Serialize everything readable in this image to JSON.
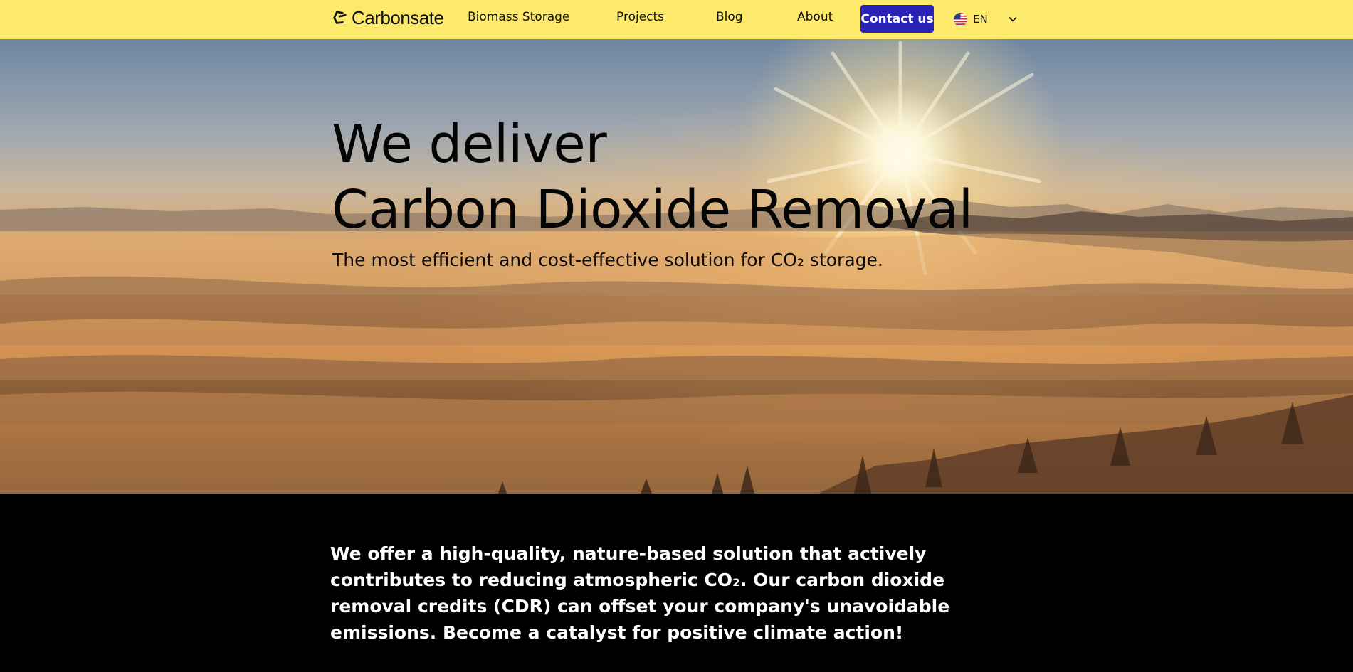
{
  "brand": {
    "name": "Carbonsate"
  },
  "nav": {
    "items": [
      {
        "label": "Biomass Storage"
      },
      {
        "label": "Projects"
      },
      {
        "label": "Blog"
      },
      {
        "label": "About"
      }
    ],
    "contact_label": "Contact us",
    "language": {
      "code": "EN",
      "flag": "us-flag-icon"
    }
  },
  "hero": {
    "title_line1": "We deliver",
    "title_line2": "Carbon Dioxide Removal",
    "subtitle": "The most efficient and cost-effective solution for CO₂ storage."
  },
  "intro": {
    "text": "We offer a high-quality, nature-based solution that actively contributes to reducing atmospheric CO₂. Our carbon dioxide removal credits (CDR) can offset your company's unavoidable emissions. Become a catalyst for positive climate action!"
  },
  "colors": {
    "header_bg": "#fde96b",
    "button_bg": "#2a21b6",
    "intro_bg": "#000000"
  }
}
